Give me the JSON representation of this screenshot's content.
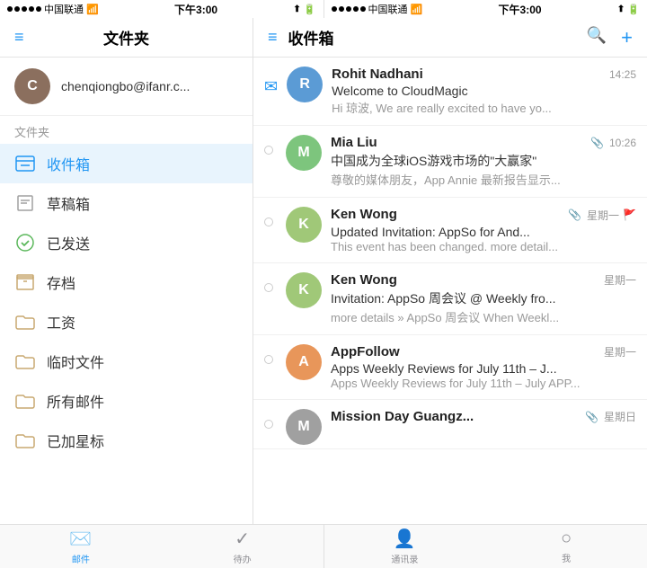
{
  "left_status": {
    "carrier": "中国联通",
    "time": "下午3:00",
    "wifi": "WiFi",
    "location": "↑",
    "battery": "■"
  },
  "right_status": {
    "carrier": "中国联通",
    "time": "下午3:00",
    "battery": "■"
  },
  "left_panel": {
    "title": "文件夹",
    "account": {
      "email": "chenqiongbo@ifanr.c...",
      "avatar_letter": "C"
    },
    "folders_label": "文件夹",
    "folders": [
      {
        "name": "收件箱",
        "icon": "inbox",
        "active": true
      },
      {
        "name": "草稿箱",
        "icon": "draft",
        "active": false
      },
      {
        "name": "已发送",
        "icon": "sent",
        "active": false
      },
      {
        "name": "存档",
        "icon": "archive",
        "active": false
      },
      {
        "name": "工资",
        "icon": "folder",
        "active": false
      },
      {
        "name": "临时文件",
        "icon": "folder",
        "active": false
      },
      {
        "name": "所有邮件",
        "icon": "folder",
        "active": false
      },
      {
        "name": "已加星标",
        "icon": "folder",
        "active": false
      }
    ]
  },
  "right_panel": {
    "title": "收件箱",
    "emails": [
      {
        "sender": "Rohit Nadhani",
        "subject": "Welcome to CloudMagic",
        "preview": "Hi 琼波, We are really excited to have yo...",
        "time": "14:25",
        "read": false,
        "avatar_letter": "R",
        "avatar_color": "avatar-blue",
        "has_attachment": false,
        "has_flag": false,
        "is_envelope": true
      },
      {
        "sender": "Mia Liu",
        "subject": "中国成为全球iOS游戏市场的\"大赢家\"",
        "preview": "尊敬的媒体朋友，App Annie 最新报告显示...",
        "time": "10:26",
        "read": true,
        "avatar_letter": "M",
        "avatar_color": "avatar-teal",
        "has_attachment": true,
        "has_flag": false
      },
      {
        "sender": "Ken Wong",
        "subject": "Updated Invitation: AppSo for And...",
        "preview": "This event has been changed. more detail...",
        "time": "星期一",
        "read": true,
        "avatar_letter": "K",
        "avatar_color": "avatar-green",
        "has_attachment": true,
        "has_flag": true
      },
      {
        "sender": "Ken Wong",
        "subject": "Invitation: AppSo 周会议 @ Weekly fro...",
        "preview": "more details » AppSo 周会议 When Weekl...",
        "time": "星期一",
        "read": true,
        "avatar_letter": "K",
        "avatar_color": "avatar-green",
        "has_attachment": false,
        "has_flag": false
      },
      {
        "sender": "AppFollow",
        "subject": "Apps Weekly Reviews for July 11th – J...",
        "preview": "Apps Weekly Reviews for July 11th – July APP...",
        "time": "星期一",
        "read": true,
        "avatar_letter": "A",
        "avatar_color": "avatar-orange",
        "has_attachment": false,
        "has_flag": false
      },
      {
        "sender": "Mission Day Guangz...",
        "subject": "",
        "preview": "",
        "time": "星期日",
        "read": true,
        "avatar_letter": "M",
        "avatar_color": "avatar-gray",
        "has_attachment": true,
        "has_flag": false,
        "partial": true
      }
    ]
  },
  "tab_bar": {
    "left_tabs": [
      {
        "label": "邮件",
        "active": true
      },
      {
        "label": "待办",
        "active": false
      }
    ],
    "right_tabs": [
      {
        "label": "通讯录",
        "active": false
      },
      {
        "label": "我",
        "active": false
      }
    ]
  }
}
